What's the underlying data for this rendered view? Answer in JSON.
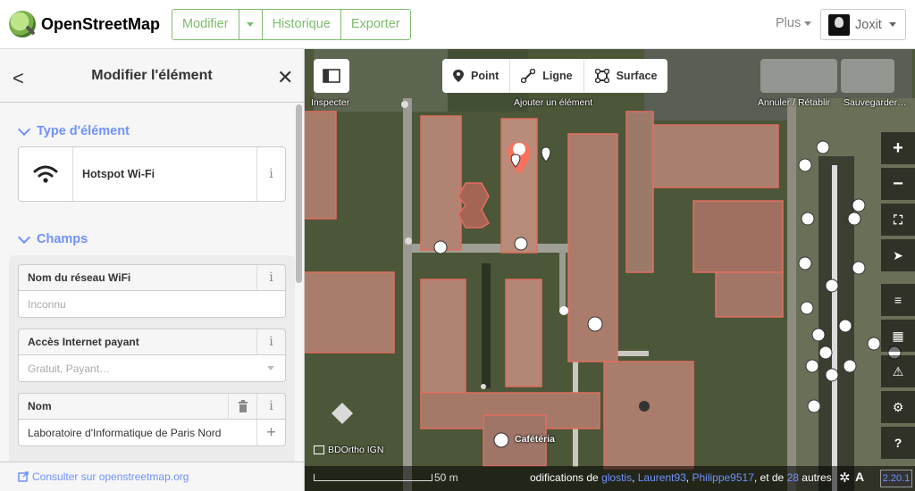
{
  "header": {
    "brand": "OpenStreetMap",
    "edit_label": "Modifier",
    "history_label": "Historique",
    "export_label": "Exporter",
    "more_label": "Plus",
    "username": "Joxit"
  },
  "sidebar": {
    "title": "Modifier l'élément",
    "type_section": "Type d'élément",
    "preset_name": "Hotspot Wi-Fi",
    "fields_section": "Champs",
    "fields": [
      {
        "label": "Nom du réseau WiFi",
        "value": "",
        "placeholder": "Inconnu"
      },
      {
        "label": "Accès Internet payant",
        "value": "",
        "placeholder": "Gratuit, Payant…"
      },
      {
        "label": "Nom",
        "value": "Laboratoire d'Informatique de Paris Nord",
        "placeholder": ""
      }
    ],
    "footer_link": "Consulter sur openstreetmap.org"
  },
  "map": {
    "inspect_label": "Inspecter",
    "point_label": "Point",
    "line_label": "Ligne",
    "area_label": "Surface",
    "add_feature_label": "Ajouter un élément",
    "undo_redo_label": "Annuler / Rétablir",
    "save_label": "Sauvegarder…",
    "cafeteria_label": "Cafétéria",
    "imagery_label": "BDOrtho IGN",
    "scale_label": "50 m",
    "attribution_prefix": "odifications de",
    "attribution_user1": "glostis",
    "attribution_user2": "Laurent93",
    "attribution_user3": "Philippe9517",
    "attribution_mid": ", et de",
    "attribution_count": "28",
    "attribution_suffix": "autres",
    "version": "2.20.1",
    "colors": {
      "highlight": "#ff6e5a",
      "building_outline": "#e06e5f",
      "accent": "#7092ff",
      "brand_green": "#7ebc6f"
    }
  }
}
